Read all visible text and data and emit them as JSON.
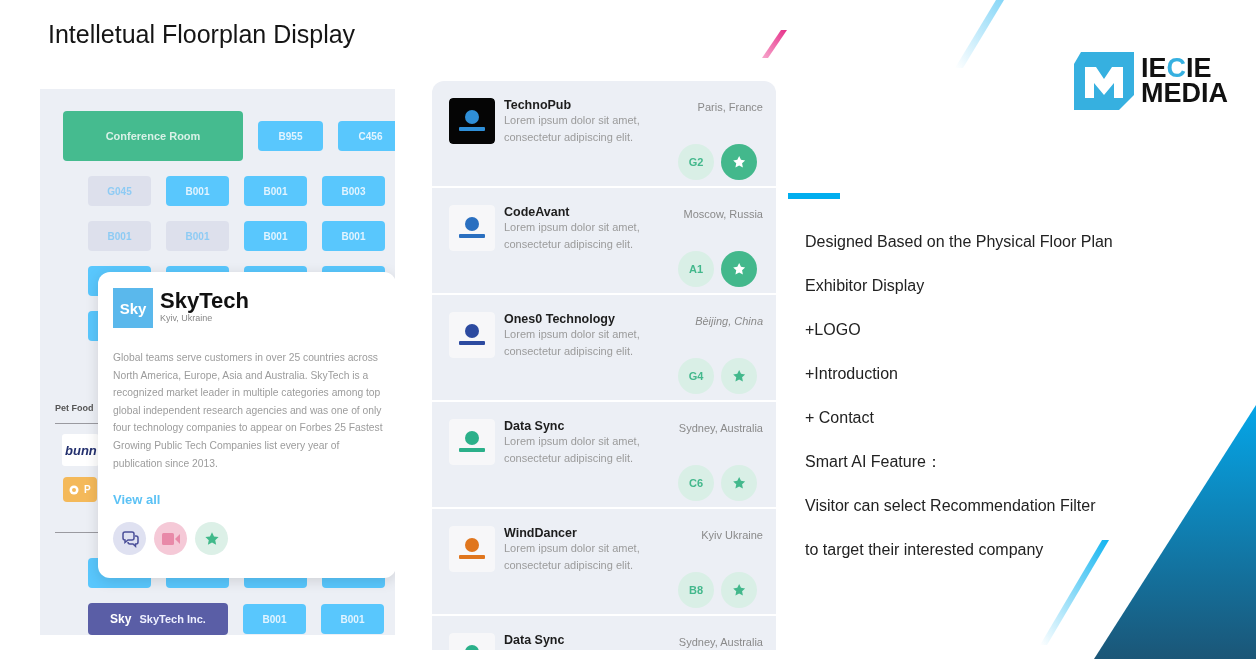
{
  "title": "Intelletual Floorplan Display",
  "brand": {
    "lines": [
      [
        {
          "text": "IE",
          "accent": false
        },
        {
          "text": "C",
          "accent": true
        },
        {
          "text": "IE",
          "accent": false
        }
      ],
      [
        {
          "text": "MEDIA",
          "accent": false
        }
      ]
    ]
  },
  "floorplan": {
    "sections": [
      {
        "kind": "row",
        "booths": [
          {
            "kind": "room",
            "label": "Conference Room"
          },
          {
            "kind": "booked",
            "label": "B955"
          },
          {
            "kind": "booked",
            "label": "C456"
          }
        ]
      },
      {
        "kind": "row",
        "booths": [
          {
            "kind": "free",
            "label": "G045"
          },
          {
            "kind": "booked",
            "label": "B001"
          },
          {
            "kind": "booked",
            "label": "B001"
          },
          {
            "kind": "booked",
            "label": "B003"
          }
        ]
      },
      {
        "kind": "row",
        "booths": [
          {
            "kind": "free",
            "label": "B001"
          },
          {
            "kind": "free",
            "label": "B001"
          },
          {
            "kind": "booked",
            "label": "B001"
          },
          {
            "kind": "booked",
            "label": "B001"
          }
        ]
      },
      {
        "kind": "row",
        "booths": [
          {
            "kind": "booked"
          },
          {
            "kind": "booked"
          },
          {
            "kind": "booked"
          },
          {
            "kind": "booked"
          }
        ]
      },
      {
        "kind": "row",
        "booths": [
          {
            "kind": "booked"
          }
        ]
      },
      {
        "kind": "category",
        "title": "Pet Food",
        "brand_logo": "bunn",
        "button_label": "P"
      },
      {
        "kind": "row",
        "booths": [
          {
            "kind": "booked"
          },
          {
            "kind": "booked"
          },
          {
            "kind": "booked"
          },
          {
            "kind": "booked"
          }
        ]
      },
      {
        "kind": "row",
        "booths": [
          {
            "kind": "exhibitor",
            "logo": "Sky",
            "label": "SkyTech Inc."
          },
          {
            "kind": "booked",
            "label": "B001"
          },
          {
            "kind": "booked",
            "label": "B001"
          }
        ]
      }
    ],
    "popup": {
      "logo": "Sky",
      "name": "SkyTech",
      "location": "Kyiv, Ukraine",
      "description": "Global teams serve customers in over 25 countries across North America, Europe, Asia and Australia. SkyTech is a recognized market leader in multiple categories among top global independent research agencies and was one of only four technology companies to appear on Forbes 25 Fastest Growing Public Tech Companies list every year of\npublication since 2013.",
      "link": "View all",
      "actions": [
        {
          "kind": "chat"
        },
        {
          "kind": "video"
        },
        {
          "kind": "favorite"
        }
      ]
    }
  },
  "exhibitors": [
    {
      "name": "TechnoPub",
      "description": "Lorem ipsum dolor sit amet, consectetur adipiscing elit.",
      "location": "Paris, France",
      "italic": false,
      "dark_logo": true,
      "color": "#2f8fd8",
      "booth": "G2",
      "favorite": true
    },
    {
      "name": "CodeAvant",
      "description": "Lorem ipsum dolor sit amet, consectetur adipiscing elit.",
      "location": "Moscow, Russia",
      "italic": false,
      "dark_logo": false,
      "color": "#2a6fc0",
      "booth": "A1",
      "favorite": true
    },
    {
      "name": "Ones0 Technology",
      "description": "Lorem ipsum dolor sit amet, consectetur adipiscing elit.",
      "location": "Bèijing, China",
      "italic": true,
      "dark_logo": false,
      "color": "#2c4aa0",
      "booth": "G4",
      "favorite": false
    },
    {
      "name": "Data Sync",
      "description": "Lorem ipsum dolor sit amet, consectetur adipiscing elit.",
      "location": "Sydney, Australia",
      "italic": false,
      "dark_logo": false,
      "color": "#2bb08a",
      "booth": "C6",
      "favorite": false
    },
    {
      "name": "WindDancer",
      "description": "Lorem ipsum dolor sit amet, consectetur adipiscing elit.",
      "location": "Kyiv Ukraine",
      "italic": false,
      "dark_logo": false,
      "color": "#e0761e",
      "booth": "B8",
      "favorite": false
    },
    {
      "name": "Data Sync",
      "location": "Sydney, Australia",
      "italic": false,
      "dark_logo": false,
      "color": "#2bb08a"
    }
  ],
  "features": [
    "Designed Based on the Physical Floor Plan",
    "Exhibitor Display",
    "+LOGO",
    "+Introduction",
    "+ Contact",
    "Smart AI Feature：",
    "Visitor can select Recommendation Filter",
    "to target their interested company"
  ]
}
